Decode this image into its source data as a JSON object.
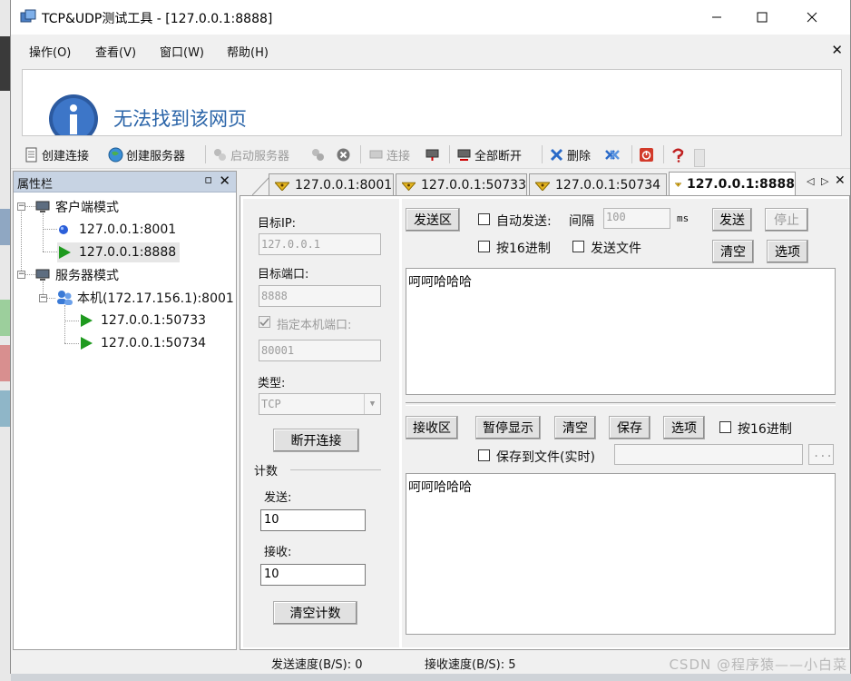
{
  "window": {
    "title": "TCP&UDP测试工具 - [127.0.0.1:8888]"
  },
  "menu": [
    "操作(O)",
    "查看(V)",
    "窗口(W)",
    "帮助(H)"
  ],
  "browser": {
    "message": "无法找到该网页"
  },
  "toolbar": {
    "create_conn": "创建连接",
    "create_server": "创建服务器",
    "start_server": "启动服务器",
    "connect": "连接",
    "disconnect_all": "全部断开",
    "delete": "删除"
  },
  "panel": {
    "title": "属性栏"
  },
  "tree": {
    "client_mode": "客户端模式",
    "client1": "127.0.0.1:8001",
    "client2": "127.0.0.1:8888",
    "server_mode": "服务器模式",
    "server_host": "本机(172.17.156.1):8001",
    "server_conn1": "127.0.0.1:50733",
    "server_conn2": "127.0.0.1:50734"
  },
  "tabs": [
    "127.0.0.1:8001",
    "127.0.0.1:50733",
    "127.0.0.1:50734",
    "127.0.0.1:8888"
  ],
  "conn": {
    "target_ip_label": "目标IP:",
    "target_ip": "127.0.0.1",
    "target_port_label": "目标端口:",
    "target_port": "8888",
    "local_port_label": "指定本机端口:",
    "local_port": "80001",
    "type_label": "类型:",
    "type_value": "TCP",
    "disconnect_btn": "断开连接"
  },
  "count": {
    "title": "计数",
    "send_label": "发送:",
    "send_value": "10",
    "recv_label": "接收:",
    "recv_value": "10",
    "clear_btn": "清空计数"
  },
  "send": {
    "area_btn": "发送区",
    "auto_send": "自动发送:",
    "interval_label": "间隔",
    "interval": "100",
    "unit": "ms",
    "send_btn": "发送",
    "stop_btn": "停止",
    "hex16": "按16进制",
    "send_file": "发送文件",
    "clear_btn": "清空",
    "options_btn": "选项",
    "content": "呵呵哈哈哈"
  },
  "recv": {
    "area_btn": "接收区",
    "pause_btn": "暂停显示",
    "clear_btn": "清空",
    "save_btn": "保存",
    "options_btn": "选项",
    "hex16": "按16进制",
    "save_file": "保存到文件(实时)",
    "browse": "...",
    "content": "呵呵哈哈哈"
  },
  "status": {
    "send_speed": "发送速度(B/S): 0",
    "recv_speed": "接收速度(B/S): 5"
  },
  "watermark": "CSDN @程序猿——小白菜"
}
